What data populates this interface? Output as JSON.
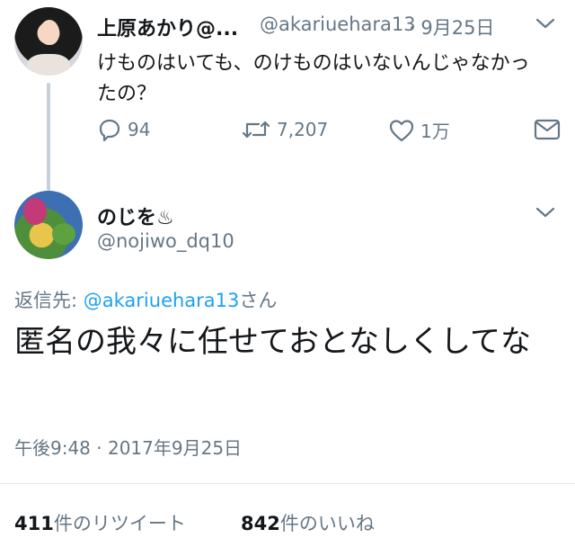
{
  "parent_tweet": {
    "display_name": "上原あかり@...",
    "handle": "@akariuehara13",
    "date": "· 9月25日",
    "text": "けものはいても、のけものはいないんじゃなかったの？",
    "replies": "94",
    "retweets": "7,207",
    "likes": "1万"
  },
  "main_tweet": {
    "display_name": "のじを♨",
    "handle": "@nojiwo_dq10",
    "reply_prefix": "返信先: ",
    "reply_mention": "@akariuehara13",
    "reply_suffix": "さん",
    "text": "匿名の我々に任せておとなしくしてな",
    "timestamp": "午後9:48 · 2017年9月25日",
    "retweet_count": "411",
    "retweet_label": "件のリツイート",
    "like_count": "842",
    "like_label": "件のいいね"
  },
  "colors": {
    "text": "#14171a",
    "secondary": "#657786",
    "link": "#1da1f2",
    "divider": "#e1e8ed"
  },
  "icons": [
    "reply-icon",
    "retweet-icon",
    "heart-icon",
    "mail-icon",
    "chevron-down-icon"
  ]
}
